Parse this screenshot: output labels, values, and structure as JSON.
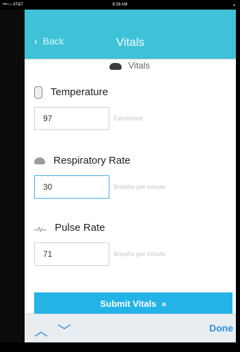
{
  "status_bar": {
    "carrier": "•••○○ AT&T",
    "time": "8:28 AM",
    "bluetooth": "⋆"
  },
  "navbar": {
    "back_label": "Back",
    "title": "Vitals"
  },
  "section": {
    "label": "Vitals"
  },
  "fields": [
    {
      "label": "Temperature",
      "value": "97",
      "unit": "Fahrenheit",
      "icon": "thermometer-icon"
    },
    {
      "label": "Respiratory Rate",
      "value": "30",
      "unit": "Breaths per minute",
      "icon": "lungs-icon"
    },
    {
      "label": "Pulse Rate",
      "value": "71",
      "unit": "Breaths per minute",
      "icon": "pulse-icon"
    }
  ],
  "submit": {
    "label": "Submit Vitals",
    "arrow": "»"
  },
  "toolbar": {
    "done_label": "Done",
    "up": "︿",
    "down": "﹀"
  },
  "colors": {
    "navbar": "#3fc2d7",
    "submit": "#24b3e6",
    "accent": "#2d8fda"
  }
}
